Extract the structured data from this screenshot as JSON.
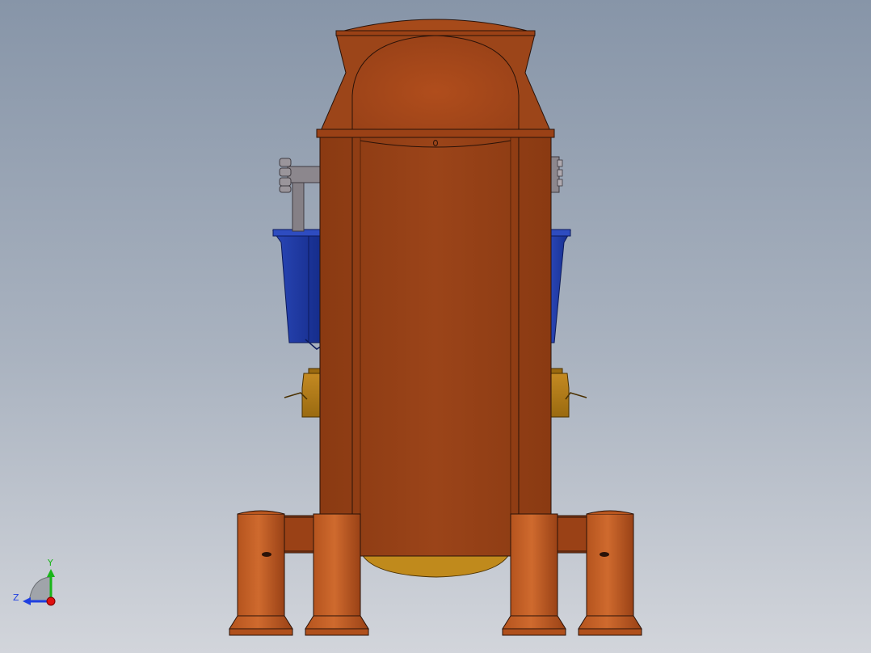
{
  "viewport": {
    "background_top": "#8795a8",
    "background_bottom": "#d2d5db"
  },
  "model": {
    "vessel_color": "#9a4218",
    "vessel_highlight": "#b1521f",
    "blue_part_color": "#1f3aa0",
    "gold_part_color": "#b8801c",
    "pipe_color": "#8a8689",
    "edge_color": "#2a1208"
  },
  "triad": {
    "y_label": "Y",
    "z_label": "Z",
    "y_color": "#19b519",
    "z_color": "#2040e0",
    "x_color": "#e01010"
  }
}
